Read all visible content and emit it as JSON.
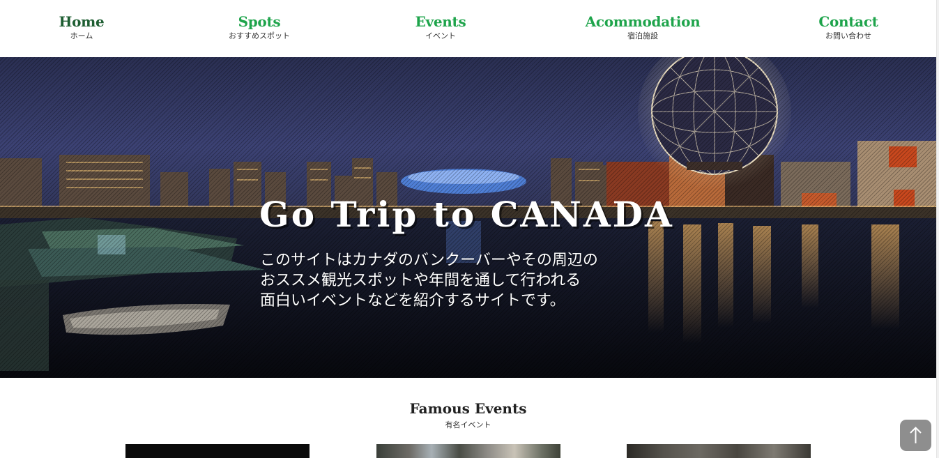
{
  "nav": {
    "items": [
      {
        "label": "Home",
        "sub": "ホーム"
      },
      {
        "label": "Spots",
        "sub": "おすすめスポット"
      },
      {
        "label": "Events",
        "sub": "イベント"
      },
      {
        "label": "Acommodation",
        "sub": "宿泊施設"
      },
      {
        "label": "Contact",
        "sub": "お問い合わせ"
      }
    ]
  },
  "hero": {
    "title": "Go Trip to CANADA",
    "description_lines": [
      "このサイトはカナダのバンクーバーやその周辺の",
      "おススメ観光スポットや年間を通して行われる",
      "面白いイベントなどを紹介するサイトです。"
    ]
  },
  "section": {
    "title": "Famous Events",
    "subtitle": "有名イベント"
  },
  "icons": {
    "to_top": "arrow-up-icon"
  },
  "colors": {
    "nav_home": "#1e5e32",
    "nav_accent": "#1ea44b",
    "to_top_bg": "#8e8e8e"
  }
}
